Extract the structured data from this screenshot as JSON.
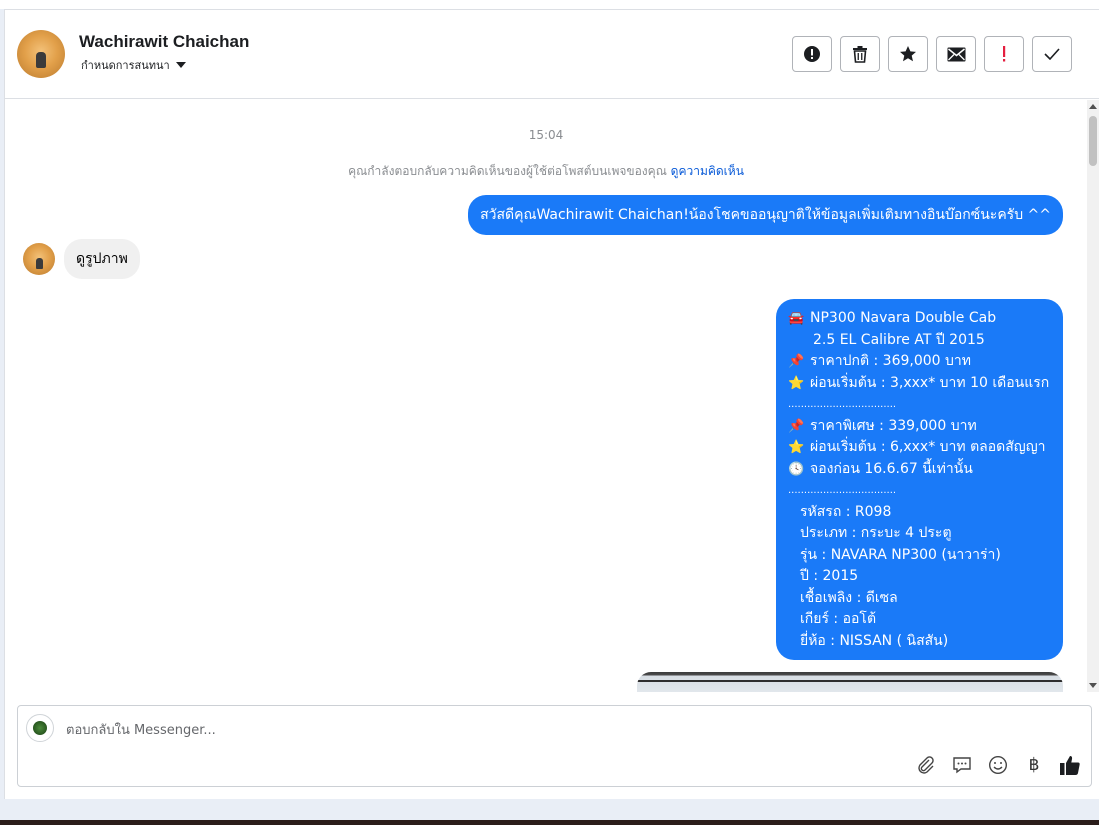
{
  "header": {
    "contact_name": "Wachirawit Chaichan",
    "assign_label": "กำหนดการสนทนา",
    "actions": [
      {
        "name": "report-button",
        "icon": "alert-circle-icon"
      },
      {
        "name": "delete-button",
        "icon": "trash-icon"
      },
      {
        "name": "star-button",
        "icon": "star-icon"
      },
      {
        "name": "mark-unread-button",
        "icon": "envelope-icon"
      },
      {
        "name": "spam-button",
        "icon": "exclamation-icon"
      },
      {
        "name": "done-button",
        "icon": "check-icon"
      }
    ]
  },
  "chat": {
    "timestamp": "15:04",
    "notice_text": "คุณกำลังตอบกลับความคิดเห็นของผู้ใช้ต่อโพสต์บนเพจของคุณ",
    "notice_link": "ดูความคิดเห็น",
    "greeting": "สวัสดีคุณWachirawit Chaichan!น้องโชคขออนุญาติให้ข้อมูลเพิ่มเติมทางอินบ๊อกซ์นะครับ ^^",
    "incoming_text": "ดูรูปภาพ",
    "details": {
      "title_line1": "NP300 Navara Double Cab",
      "title_line2": "2.5 EL Calibre AT ปี 2015",
      "normal_price": "ราคาปกติ : 369,000 บาท",
      "installment_1": "ผ่อนเริ่มต้น : 3,xxx* บาท 10 เดือนแรก",
      "separator": "..................................",
      "special_price": "ราคาพิเศษ : 339,000 บาท",
      "installment_2": "ผ่อนเริ่มต้น : 6,xxx* บาท ตลอดสัญญา",
      "booking": "จองก่อน 16.6.67 นี้เท่านั้น",
      "code": "รหัสรถ : R098",
      "type": "ประเภท : กระบะ 4 ประตู",
      "model": "รุ่น : NAVARA NP300 (นาวาร่า)",
      "year": "ปี : 2015",
      "fuel": "เชื้อเพลิง : ดีเซล",
      "gear": "เกียร์ : ออโต้",
      "brand": "ยี่ห้อ : NISSAN ( นิสสัน)",
      "emoji_car": "🚘",
      "emoji_pin": "📌",
      "emoji_star": "⭐",
      "emoji_clock": "🕓"
    }
  },
  "composer": {
    "placeholder": "ตอบกลับใน Messenger...",
    "currency_symbol": "฿"
  },
  "colors": {
    "bubble_out": "#1a7af8",
    "bubble_in": "#f0f0f0",
    "link": "#0a5bd8",
    "spam_icon": "#e41e3f"
  }
}
